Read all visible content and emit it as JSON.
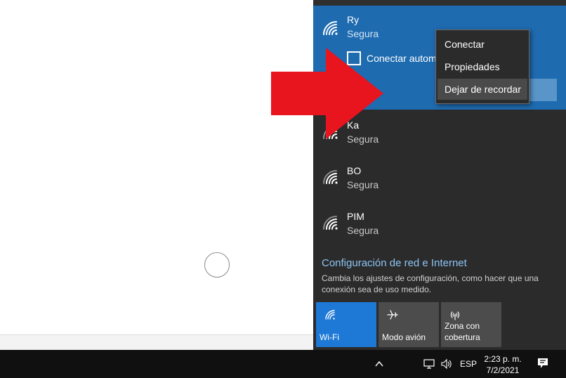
{
  "flyout": {
    "selected_network": {
      "name": "Ry",
      "status": "Segura",
      "auto_connect_label": "Conectar autom"
    },
    "context_menu": [
      {
        "label": "Conectar"
      },
      {
        "label": "Propiedades"
      },
      {
        "label": "Dejar de recordar"
      }
    ],
    "networks": [
      {
        "name": "Ka",
        "status": "Segura"
      },
      {
        "name": "BO",
        "status": "Segura"
      },
      {
        "name": "PIM",
        "status": "Segura"
      }
    ],
    "settings_link": "Configuración de red e Internet",
    "settings_desc": "Cambia los ajustes de configuración, como hacer que una conexión sea de uso medido.",
    "tiles": [
      {
        "label": "Wi-Fi",
        "active": true
      },
      {
        "label": "Modo avión",
        "active": false
      },
      {
        "label": "Zona con cobertura",
        "active": false
      }
    ]
  },
  "taskbar": {
    "language": "ESP",
    "time": "2:23 p. m.",
    "date": "7/2/2021"
  },
  "colors": {
    "flyout_bg": "#2b2b2b",
    "selected_bg": "#1e6bb0",
    "accent_link": "#8cc4f5",
    "tile_active": "#1e78d6",
    "arrow": "#e8141e"
  }
}
